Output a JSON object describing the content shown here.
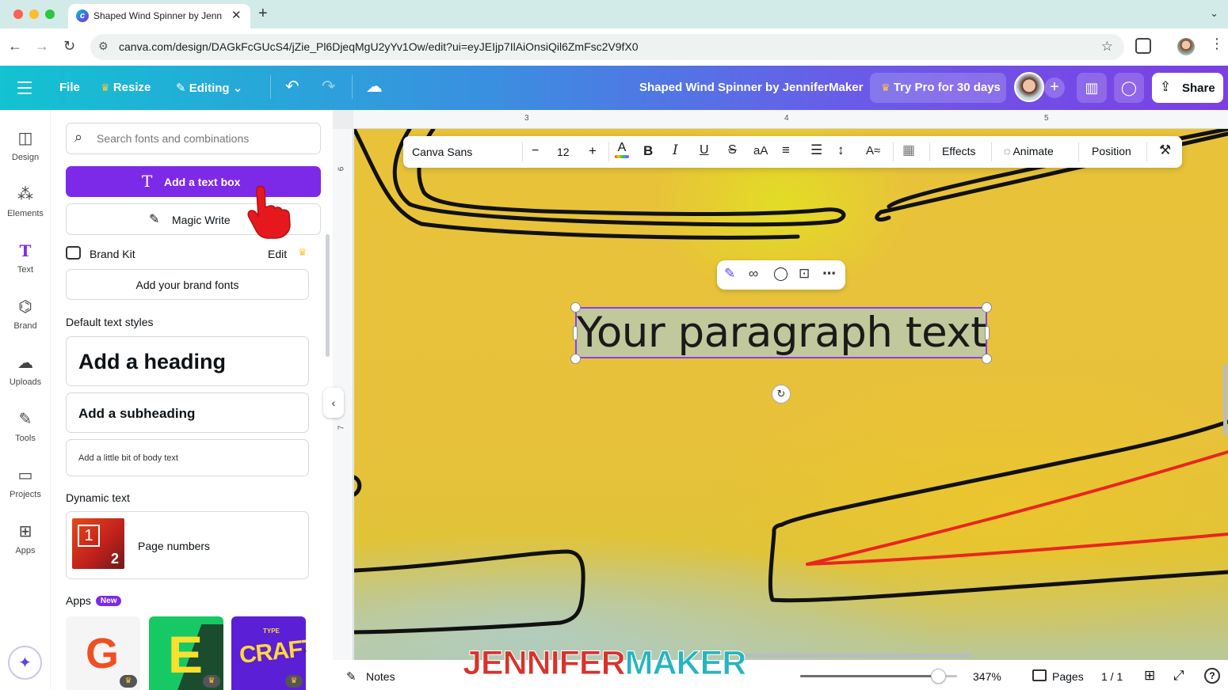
{
  "browser": {
    "tab_title": "Shaped Wind Spinner by Jenn",
    "url": "canva.com/design/DAGkFcGUcS4/jZie_Pl6DjeqMgU2yYv1Ow/edit?ui=eyJEIjp7IlAiOnsiQil6ZmFsc2V9fX0"
  },
  "header": {
    "file": "File",
    "resize": "Resize",
    "editing": "Editing",
    "doc_title": "Shaped Wind Spinner by JenniferMaker",
    "try_pro": "Try Pro for 30 days",
    "share": "Share"
  },
  "rail": {
    "items": [
      {
        "label": "Design",
        "icon": "layout-icon"
      },
      {
        "label": "Elements",
        "icon": "shapes-icon"
      },
      {
        "label": "Text",
        "icon": "text-icon"
      },
      {
        "label": "Brand",
        "icon": "brand-icon"
      },
      {
        "label": "Uploads",
        "icon": "cloud-upload-icon"
      },
      {
        "label": "Tools",
        "icon": "pen-icon"
      },
      {
        "label": "Projects",
        "icon": "folder-icon"
      },
      {
        "label": "Apps",
        "icon": "apps-icon"
      }
    ]
  },
  "panel": {
    "search_placeholder": "Search fonts and combinations",
    "add_text_box": "Add a text box",
    "magic_write": "Magic Write",
    "brand_kit": "Brand Kit",
    "brand_kit_edit": "Edit",
    "add_brand_fonts": "Add your brand fonts",
    "default_styles_title": "Default text styles",
    "heading": "Add a heading",
    "subheading": "Add a subheading",
    "body": "Add a little bit of body text",
    "dynamic_title": "Dynamic text",
    "thumb_n1": "1",
    "thumb_n2": "2",
    "page_numbers": "Page numbers",
    "apps_title": "Apps",
    "new_badge": "New",
    "app_tile_g": "G",
    "app_tile_e": "E",
    "app_tile_c": "CRAFT",
    "app_tile_c_top": "TYPE"
  },
  "rulers": {
    "top": [
      "3",
      "4",
      "5"
    ],
    "left": [
      "6",
      "7"
    ]
  },
  "text_toolbar": {
    "font": "Canva Sans",
    "size": "12",
    "effects": "Effects",
    "animate": "Animate",
    "position": "Position"
  },
  "canvas": {
    "selected_text": "Your paragraph text"
  },
  "bottom_bar": {
    "notes": "Notes",
    "zoom": "347%",
    "zoom_level_fraction": 0.88,
    "pages": "Pages",
    "page_count": "1 / 1"
  },
  "watermark": {
    "part1": "JENNIFER",
    "part2": "MAKER"
  },
  "colors": {
    "accent": "#7d2ae8",
    "header_start": "#12c3d1",
    "header_end": "#7b3fe4",
    "design_background": "#e8c339",
    "outline_red": "#e8261e"
  }
}
